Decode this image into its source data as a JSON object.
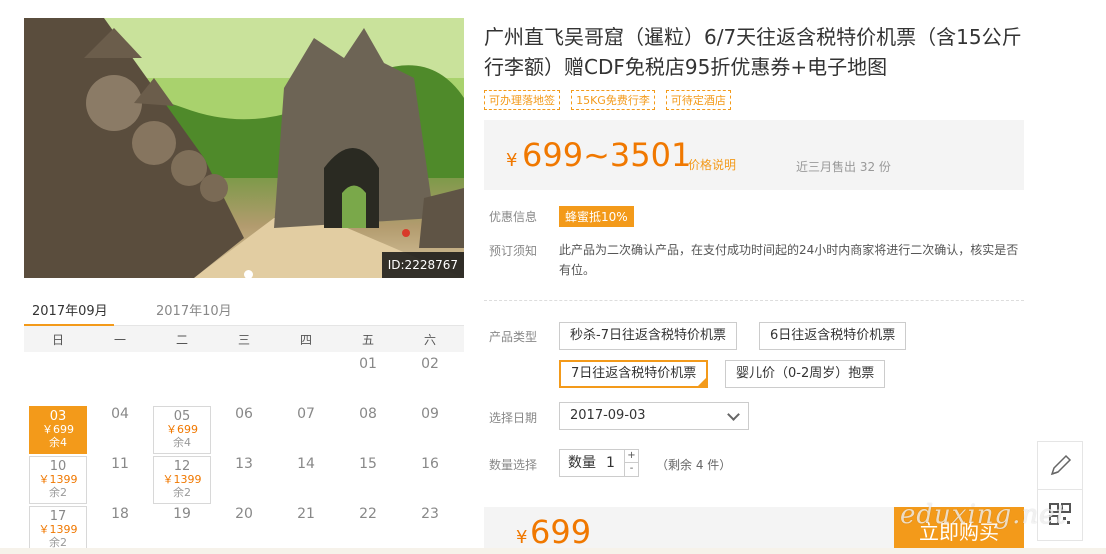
{
  "hero": {
    "id_tag": "ID:2228767"
  },
  "calendar": {
    "tabs": [
      "2017年09月",
      "2017年10月"
    ],
    "weekdays": [
      "日",
      "一",
      "二",
      "三",
      "四",
      "五",
      "六"
    ],
    "row1": [
      "01",
      "02"
    ],
    "row2": {
      "sel": {
        "d": "03",
        "p": "￥699",
        "r": "余4"
      },
      "d04": "04",
      "box": {
        "d": "05",
        "p": "￥699",
        "r": "余4"
      },
      "rest": [
        "06",
        "07",
        "08",
        "09"
      ]
    },
    "row3": {
      "box1": {
        "d": "10",
        "p": "￥1399",
        "r": "余2"
      },
      "d11": "11",
      "box2": {
        "d": "12",
        "p": "￥1399",
        "r": "余2"
      },
      "rest": [
        "13",
        "14",
        "15",
        "16"
      ]
    },
    "row4": {
      "box1": {
        "d": "17",
        "p": "￥1399",
        "r": "余2"
      },
      "rest": [
        "18",
        "19",
        "20",
        "21",
        "22",
        "23"
      ]
    }
  },
  "product": {
    "title": "广州直飞吴哥窟（暹粒）6/7天往返含税特价机票（含15公斤行李额）赠CDF免税店95折优惠券+电子地图",
    "tags": [
      "可办理落地签",
      "15KG免费行李",
      "可待定酒店"
    ],
    "price_symbol": "¥",
    "price_range": "699~3501",
    "price_explain": "价格说明",
    "sold_recent": "近三月售出 32 份"
  },
  "info": {
    "promo_label": "优惠信息",
    "promo_badge": "蜂蜜抵10%",
    "notice_label": "预订须知",
    "notice_text": "此产品为二次确认产品，在支付成功时间起的24小时内商家将进行二次确认，核实是否有位。"
  },
  "options": {
    "type_label": "产品类型",
    "types": [
      "秒杀-7日往返含税特价机票",
      "6日往返含税特价机票",
      "7日往返含税特价机票",
      "婴儿价（0-2周岁）抱票"
    ],
    "date_label": "选择日期",
    "date_value": "2017-09-03",
    "qty_label": "数量选择",
    "qty_prefix": "数量",
    "qty_value": "1",
    "qty_plus": "+",
    "qty_minus": "-",
    "remain": "（剩余 4 件）"
  },
  "buy": {
    "price_symbol": "¥",
    "price": "699",
    "button": "立即购买"
  },
  "watermark": "eduxing.net",
  "colors": {
    "accent": "#f39a1a",
    "price": "#f07800"
  }
}
